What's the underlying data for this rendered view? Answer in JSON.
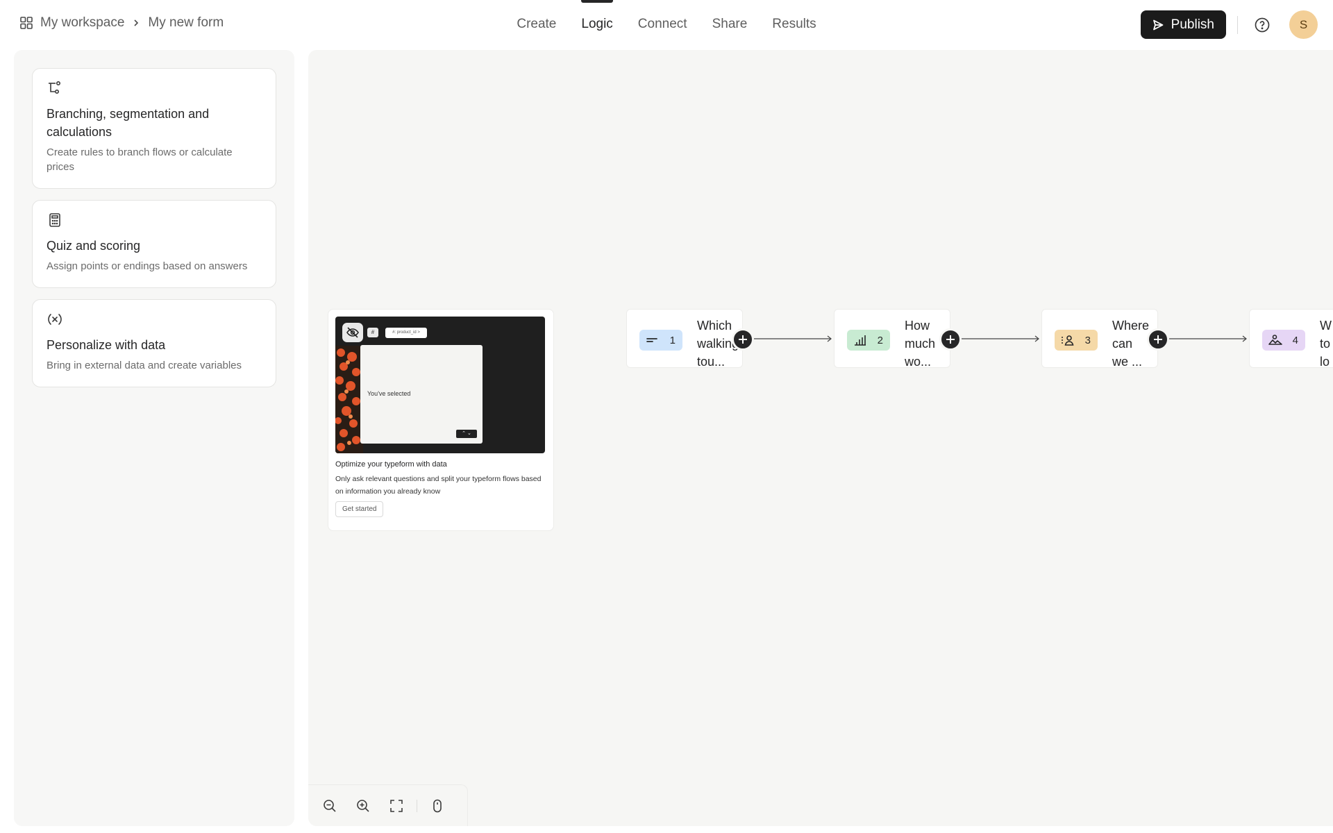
{
  "header": {
    "workspace": "My workspace",
    "form_name": "My new form",
    "tabs": [
      {
        "label": "Create",
        "active": false
      },
      {
        "label": "Logic",
        "active": true
      },
      {
        "label": "Connect",
        "active": false
      },
      {
        "label": "Share",
        "active": false
      },
      {
        "label": "Results",
        "active": false
      }
    ],
    "publish_label": "Publish",
    "avatar_initial": "S"
  },
  "sidebar": {
    "cards": [
      {
        "icon": "branch-icon",
        "title": "Branching, segmentation and calculations",
        "description": "Create rules to branch flows or calculate prices"
      },
      {
        "icon": "calculator-icon",
        "title": "Quiz and scoring",
        "description": "Assign points or endings based on answers"
      },
      {
        "icon": "variable-icon",
        "title": "Personalize with data",
        "description": "Bring in external data and create variables"
      }
    ]
  },
  "promo": {
    "hidden_field_chip": "#: product_id >",
    "preview_text": "You've selected",
    "title": "Optimize your typeform with data",
    "description": "Only ask relevant questions and split your typeform flows based on information you already know",
    "button_label": "Get started"
  },
  "nodes": [
    {
      "number": "1",
      "text": "Which\nwalking\ntou...",
      "icon": "short-text-icon",
      "color": "#cfe4fb"
    },
    {
      "number": "2",
      "text": "How\nmuch\nwo...",
      "icon": "opinion-scale-icon",
      "color": "#c8ebd2"
    },
    {
      "number": "3",
      "text": "Where\ncan\nwe ...",
      "icon": "contact-info-icon",
      "color": "#f5d9a8"
    },
    {
      "number": "4",
      "text": "W\nto\nlo",
      "icon": "picture-choice-icon",
      "color": "#e6d6f5"
    }
  ]
}
